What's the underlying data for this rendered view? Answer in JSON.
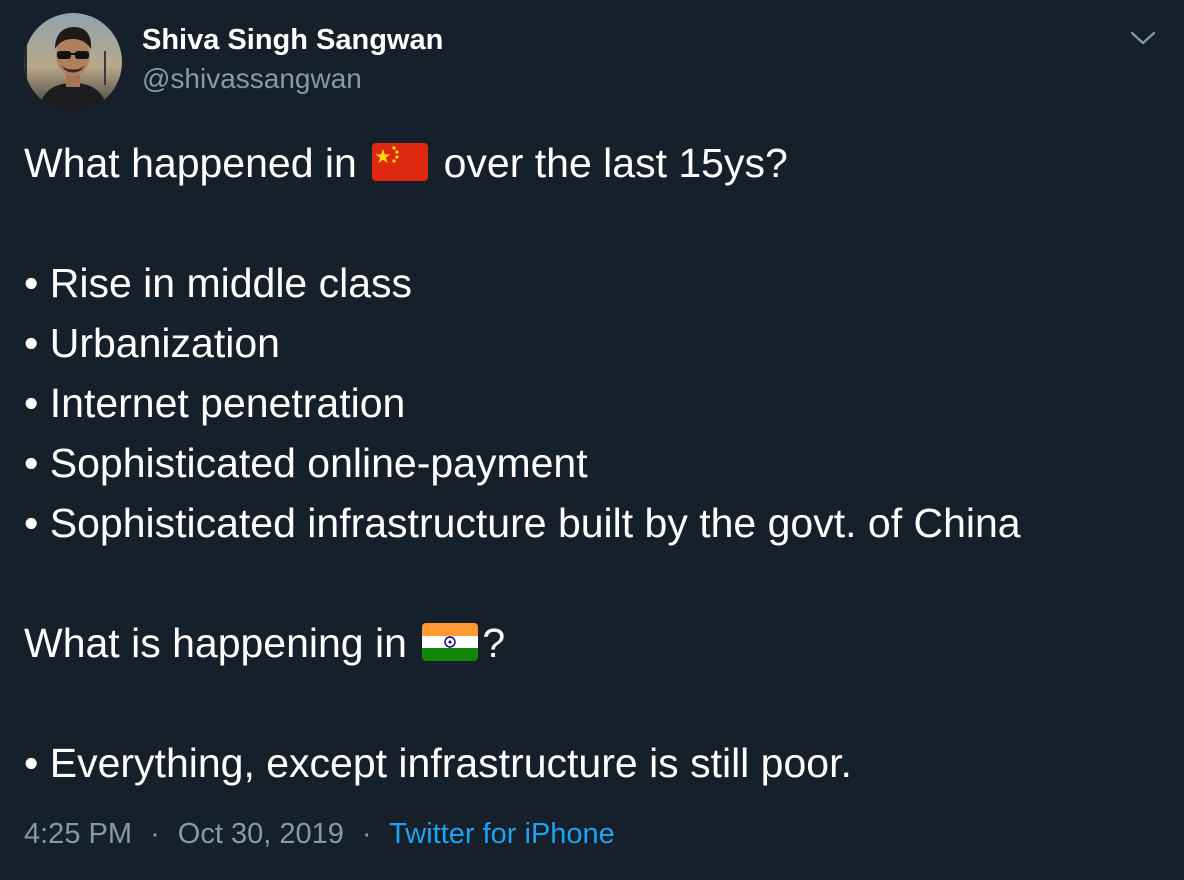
{
  "author": {
    "display_name": "Shiva Singh Sangwan",
    "handle": "@shivassangwan",
    "avatar_icon": "profile-photo"
  },
  "menu_icon": "chevron-down-icon",
  "tweet": {
    "line1_before": "What happened in",
    "line1_flag": "china-flag-icon",
    "line1_after": "over the last 15ys?",
    "bullets_1": [
      "• Rise in middle class",
      "• Urbanization",
      "• Internet penetration",
      "• Sophisticated online-payment",
      "• Sophisticated infrastructure built by the govt. of China"
    ],
    "line2_before": "What is happening in",
    "line2_flag": "india-flag-icon",
    "line2_after": "?",
    "bullets_2": [
      "• Everything, except infrastructure is still poor."
    ]
  },
  "meta": {
    "time": "4:25 PM",
    "separator": "·",
    "date": "Oct 30, 2019",
    "source": "Twitter for iPhone"
  },
  "colors": {
    "background": "#15202b",
    "text": "#ffffff",
    "secondary": "#8899a6",
    "link": "#1da1f2"
  }
}
